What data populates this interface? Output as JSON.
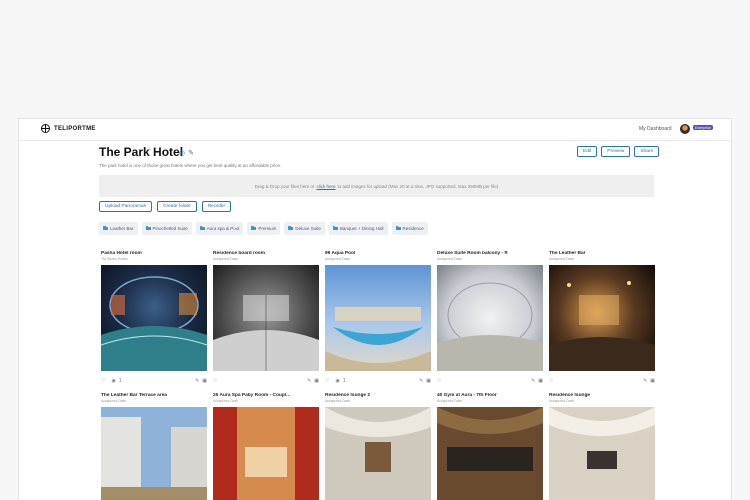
{
  "app": {
    "logo_text": "TELIPORTME"
  },
  "topbar": {
    "dashboard_link": "My Dashboard",
    "user_name": "",
    "user_badge": "Enterprise"
  },
  "page": {
    "title": "The Park Hotel",
    "subtitle": "The park hotel is one of those great hotels where you get best quality at an affordable price."
  },
  "header_buttons": {
    "edit": "Edit",
    "preview": "Preview",
    "share": "Share"
  },
  "dropzone": {
    "text_before": "Drag & Drop your files here or",
    "link": "click here",
    "text_after": "to add images for upload (Max 20 at a time, JPG supported, Max 250MB per file)"
  },
  "actions": {
    "upload": "Upload Panoramas",
    "create_folder": "Create folder",
    "reorder": "Reorder"
  },
  "folders": [
    "Leather Bar",
    "Pinochetted Suite",
    "Aura spa & Pool",
    "Premium",
    "Deluxe Suite",
    "Banquet + Dining Hall",
    "Residence"
  ],
  "cards_row1": [
    {
      "title": "Pasha Hotel room",
      "sub": "TM Studio Hotels"
    },
    {
      "title": "Residence board room",
      "sub": "Aurapuma Dash"
    },
    {
      "title": "99 Aqua Pool",
      "sub": "Aurapuma Dash"
    },
    {
      "title": "Deluxe Suite Room balcony - ft",
      "sub": "Aurapuma Dash"
    },
    {
      "title": "The Leather Bar",
      "sub": "Aurapuma Dash"
    }
  ],
  "cards_row2": [
    {
      "title": "The Leather Bar Terrace area",
      "sub": "Aurapuma Dash"
    },
    {
      "title": "25 Aura Spa Paby Room - Coupl...",
      "sub": "Aurapuma Dash"
    },
    {
      "title": "Residence lounge 2",
      "sub": "Aurapuma Dash"
    },
    {
      "title": "40 Gym at Aura - 7th Floor",
      "sub": "Aurapuma Dash"
    },
    {
      "title": "Residence lounge",
      "sub": "Aurapuma Dash"
    }
  ],
  "card_footers": [
    {
      "likes": "",
      "views": "1"
    },
    {
      "likes": "",
      "views": ""
    },
    {
      "likes": "",
      "views": "1"
    },
    {
      "likes": "",
      "views": ""
    },
    {
      "likes": "",
      "views": ""
    }
  ],
  "colors": {
    "accent": "#2a74b5",
    "badge": "#5b4fb8",
    "dropzone": "#efefef",
    "tag_bg": "#eef1f4"
  },
  "icons": {
    "title_icons": [
      "globe-icon",
      "pencil-icon"
    ],
    "card_icons": [
      "heart-icon",
      "eye-icon",
      "pencil-icon",
      "trash-icon"
    ]
  }
}
